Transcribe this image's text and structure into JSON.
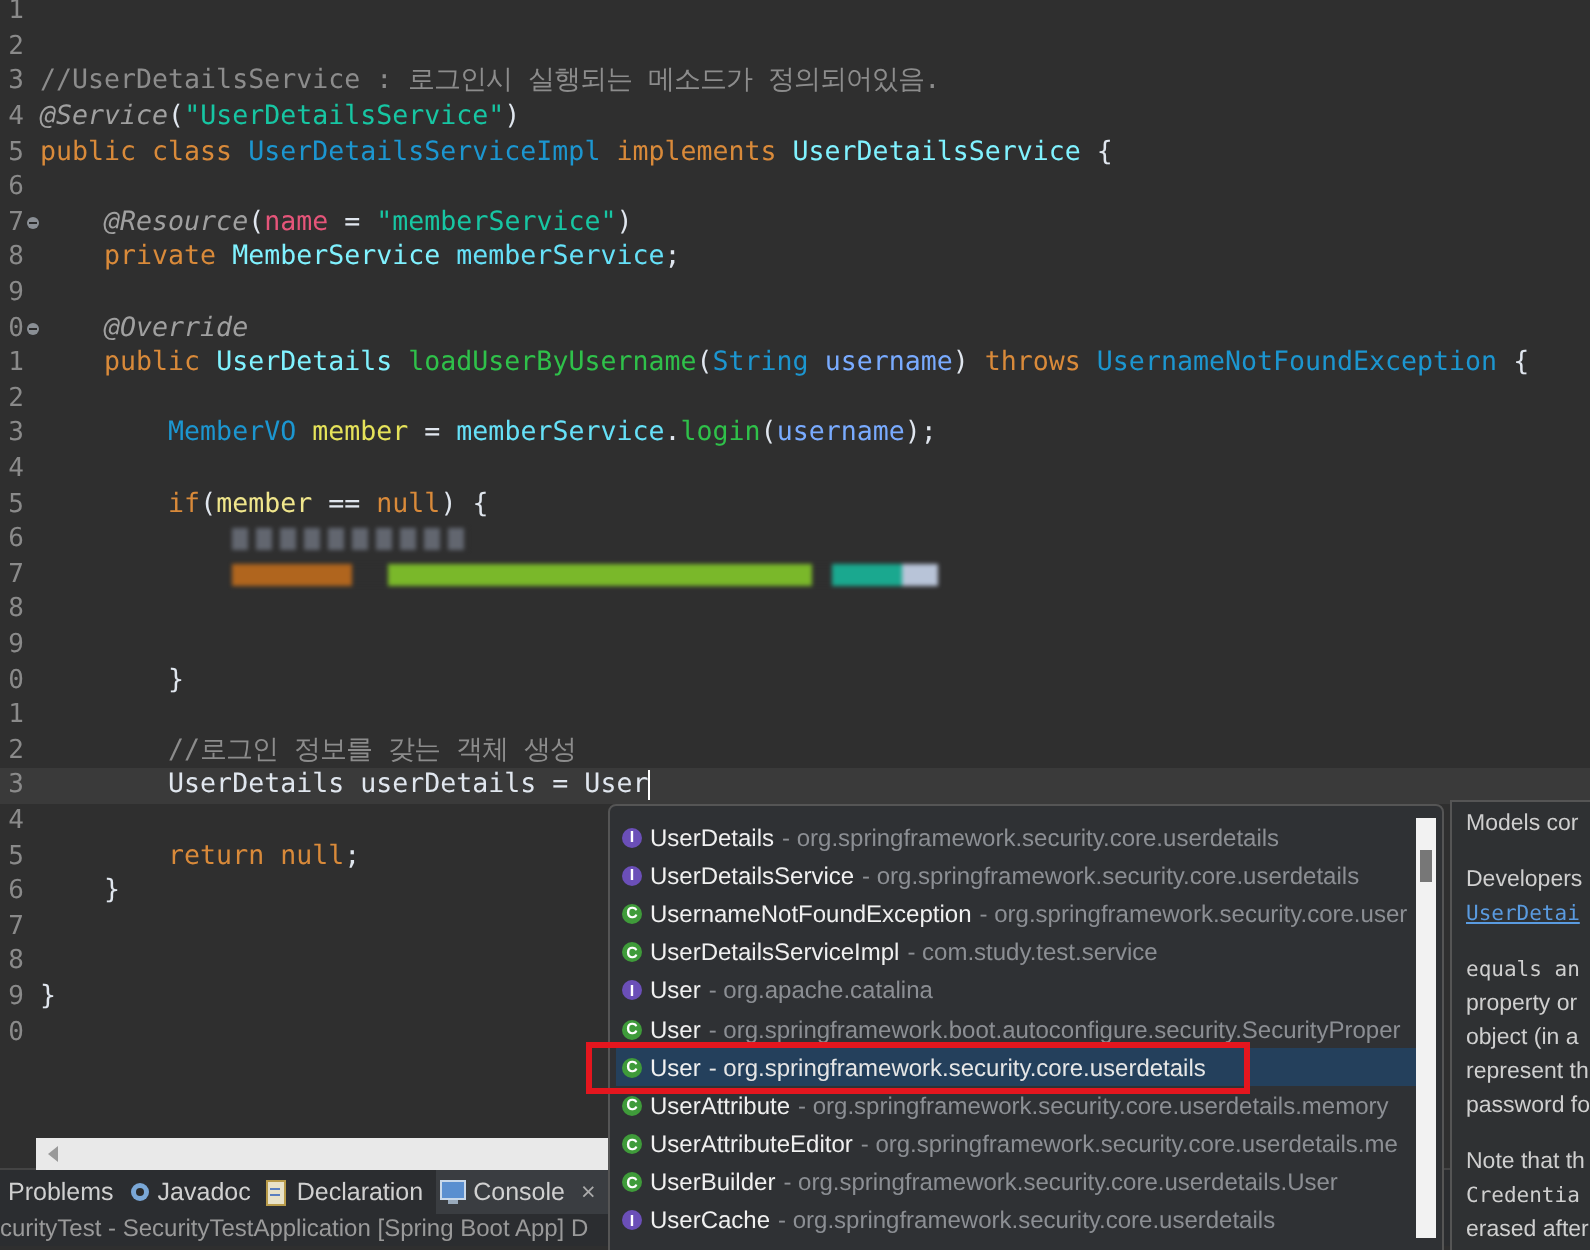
{
  "editor": {
    "lines": [
      {
        "number": "1",
        "kind": "code"
      },
      {
        "number": "2",
        "kind": "code"
      },
      {
        "number": "3",
        "kind": "code",
        "tokens": [
          {
            "kind": "comment",
            "text": "//UserDetailsService : 로그인시 실행되는 메소드가 정의되어있음."
          }
        ]
      },
      {
        "number": "4",
        "kind": "code",
        "tokens": [
          {
            "kind": "annotation",
            "text": "@Service"
          },
          {
            "kind": "plain",
            "text": "("
          },
          {
            "kind": "string",
            "text": "\"UserDetailsService\""
          },
          {
            "kind": "plain",
            "text": ")"
          }
        ]
      },
      {
        "number": "5",
        "kind": "code",
        "tokens": [
          {
            "kind": "keyword",
            "text": "public class "
          },
          {
            "kind": "classname",
            "text": "UserDetailsServiceImpl"
          },
          {
            "kind": "keyword",
            "text": " implements "
          },
          {
            "kind": "type",
            "text": "UserDetailsService"
          },
          {
            "kind": "plain",
            "text": " {"
          }
        ]
      },
      {
        "number": "6",
        "kind": "code"
      },
      {
        "number": "7",
        "kind": "code",
        "marker": true,
        "tokens": [
          {
            "kind": "annotation",
            "text": "    @Resource"
          },
          {
            "kind": "plain",
            "text": "("
          },
          {
            "kind": "attr",
            "text": "name"
          },
          {
            "kind": "plain",
            "text": " = "
          },
          {
            "kind": "string",
            "text": "\"memberService\""
          },
          {
            "kind": "plain",
            "text": ")"
          }
        ]
      },
      {
        "number": "8",
        "kind": "code",
        "tokens": [
          {
            "kind": "keyword",
            "text": "    private "
          },
          {
            "kind": "type",
            "text": "MemberService "
          },
          {
            "kind": "field",
            "text": "memberService"
          },
          {
            "kind": "plain",
            "text": ";"
          }
        ]
      },
      {
        "number": "9",
        "kind": "code"
      },
      {
        "number": "0",
        "kind": "code",
        "marker": true,
        "tokens": [
          {
            "kind": "annotation",
            "text": "    @Override"
          }
        ]
      },
      {
        "number": "1",
        "kind": "code",
        "tokens": [
          {
            "kind": "keyword",
            "text": "    public "
          },
          {
            "kind": "type",
            "text": "UserDetails "
          },
          {
            "kind": "method",
            "text": "loadUserByUsername"
          },
          {
            "kind": "plain",
            "text": "("
          },
          {
            "kind": "classname",
            "text": "String "
          },
          {
            "kind": "param",
            "text": "username"
          },
          {
            "kind": "plain",
            "text": ") "
          },
          {
            "kind": "keyword",
            "text": "throws "
          },
          {
            "kind": "classname",
            "text": "UsernameNotFoundException"
          },
          {
            "kind": "plain",
            "text": " {"
          }
        ]
      },
      {
        "number": "2",
        "kind": "code"
      },
      {
        "number": "3",
        "kind": "code",
        "tokens": [
          {
            "kind": "classname",
            "text": "        MemberVO "
          },
          {
            "kind": "local",
            "text": "member"
          },
          {
            "kind": "plain",
            "text": " = "
          },
          {
            "kind": "field",
            "text": "memberService"
          },
          {
            "kind": "plain",
            "text": "."
          },
          {
            "kind": "method",
            "text": "login"
          },
          {
            "kind": "plain",
            "text": "("
          },
          {
            "kind": "param",
            "text": "username"
          },
          {
            "kind": "plain",
            "text": ");"
          }
        ]
      },
      {
        "number": "4",
        "kind": "code"
      },
      {
        "number": "5",
        "kind": "code",
        "tokens": [
          {
            "kind": "keyword",
            "text": "        if"
          },
          {
            "kind": "plain",
            "text": "("
          },
          {
            "kind": "localuse",
            "text": "member"
          },
          {
            "kind": "plain",
            "text": " == "
          },
          {
            "kind": "keyword",
            "text": "null"
          },
          {
            "kind": "plain",
            "text": ") {"
          }
        ]
      },
      {
        "number": "6",
        "kind": "redacted"
      },
      {
        "number": "7",
        "kind": "redacted"
      },
      {
        "number": "8",
        "kind": "code"
      },
      {
        "number": "9",
        "kind": "code"
      },
      {
        "number": "0",
        "kind": "code",
        "tokens": [
          {
            "kind": "plain",
            "text": "        }"
          }
        ]
      },
      {
        "number": "1",
        "kind": "code"
      },
      {
        "number": "2",
        "kind": "code",
        "tokens": [
          {
            "kind": "comment",
            "text": "        //로그인 정보를 갖는 객체 생성"
          }
        ]
      },
      {
        "number": "3",
        "kind": "code",
        "current": true,
        "tokens": [
          {
            "kind": "plain",
            "text": "        UserDetails userDetails = User"
          }
        ]
      },
      {
        "number": "4",
        "kind": "code"
      },
      {
        "number": "5",
        "kind": "code",
        "tokens": [
          {
            "kind": "keyword",
            "text": "        return null"
          },
          {
            "kind": "plain",
            "text": ";"
          }
        ]
      },
      {
        "number": "6",
        "kind": "code",
        "tokens": [
          {
            "kind": "plain",
            "text": "    }"
          }
        ]
      },
      {
        "number": "7",
        "kind": "code"
      },
      {
        "number": "8",
        "kind": "code"
      },
      {
        "number": "9",
        "kind": "code",
        "tokens": [
          {
            "kind": "plain",
            "text": "}"
          }
        ]
      },
      {
        "number": "0",
        "kind": "code"
      }
    ]
  },
  "completion": {
    "items": [
      {
        "kind": "interface",
        "icon": "I",
        "name": "UserDetails",
        "package": "- org.springframework.security.core.userdetails",
        "selected": false
      },
      {
        "kind": "interface",
        "icon": "I",
        "name": "UserDetailsService",
        "package": "- org.springframework.security.core.userdetails",
        "selected": false
      },
      {
        "kind": "class",
        "icon": "C",
        "name": "UsernameNotFoundException",
        "package": "- org.springframework.security.core.user",
        "selected": false
      },
      {
        "kind": "class",
        "icon": "C",
        "name": "UserDetailsServiceImpl",
        "package": "- com.study.test.service",
        "selected": false
      },
      {
        "kind": "interface",
        "icon": "I",
        "name": "User",
        "package": "- org.apache.catalina",
        "selected": false
      },
      {
        "kind": "class",
        "icon": "C",
        "name": "User",
        "package": "- org.springframework.boot.autoconfigure.security.SecurityProper",
        "selected": false
      },
      {
        "kind": "class",
        "icon": "C",
        "name": "User",
        "package": "- org.springframework.security.core.userdetails",
        "selected": true
      },
      {
        "kind": "class",
        "icon": "C",
        "name": "UserAttribute",
        "package": "- org.springframework.security.core.userdetails.memory",
        "selected": false
      },
      {
        "kind": "class",
        "icon": "C",
        "name": "UserAttributeEditor",
        "package": "- org.springframework.security.core.userdetails.me",
        "selected": false
      },
      {
        "kind": "class",
        "icon": "C",
        "name": "UserBuilder",
        "package": "- org.springframework.security.core.userdetails.User",
        "selected": false
      },
      {
        "kind": "interface",
        "icon": "I",
        "name": "UserCache",
        "package": "- org.springframework.security.core.userdetails",
        "selected": false
      }
    ],
    "doc": [
      {
        "kind": "text",
        "text": "Models cor"
      },
      {
        "kind": "gap"
      },
      {
        "kind": "text",
        "text": "Developers"
      },
      {
        "kind": "link",
        "text": "UserDetai"
      },
      {
        "kind": "gap"
      },
      {
        "kind": "code",
        "text": "equals an"
      },
      {
        "kind": "text",
        "text": "property or"
      },
      {
        "kind": "text",
        "text": "object (in a"
      },
      {
        "kind": "text",
        "text": "represent th"
      },
      {
        "kind": "text",
        "text": "password fo"
      },
      {
        "kind": "gap"
      },
      {
        "kind": "text",
        "text": "Note that th"
      },
      {
        "kind": "code",
        "text": "Credentia"
      },
      {
        "kind": "text",
        "text": "erased after"
      }
    ]
  },
  "bottom_panel": {
    "tabs": [
      {
        "label": "Problems",
        "kind": "problems",
        "selected": false
      },
      {
        "label": "Javadoc",
        "kind": "javadoc",
        "selected": false
      },
      {
        "label": "Declaration",
        "kind": "declaration",
        "selected": false
      },
      {
        "label": "Console",
        "kind": "console",
        "selected": true,
        "close": "×"
      }
    ],
    "status": "curityTest - SecurityTestApplication [Spring Boot App] D"
  }
}
